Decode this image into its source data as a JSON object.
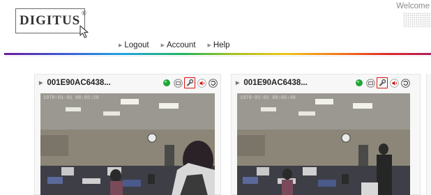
{
  "header": {
    "logo_text": "DIGITUS",
    "logo_reg": "®",
    "welcome": "Welcome"
  },
  "nav": [
    {
      "label": "Logout"
    },
    {
      "label": "Account"
    },
    {
      "label": "Help"
    }
  ],
  "colors": {
    "accent_red": "#e01010",
    "status_green": "#22a538"
  },
  "cameras": [
    {
      "name": "001E90AC6438...",
      "timestamp": "1970-01-01 00:05:20",
      "icons": [
        "status-online-icon",
        "snapshot-icon",
        "settings-wrench-icon",
        "audio-icon",
        "refresh-icon"
      ]
    },
    {
      "name": "001E90AC6438...",
      "timestamp": "1970-01-01 00:06:40",
      "icons": [
        "status-online-icon",
        "snapshot-icon",
        "settings-wrench-icon",
        "audio-icon",
        "refresh-icon"
      ]
    }
  ]
}
